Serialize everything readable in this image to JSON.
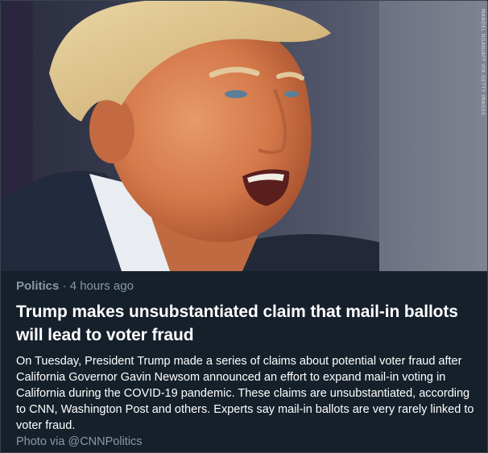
{
  "story": {
    "category": "Politics",
    "separator": "·",
    "time": "4 hours ago",
    "headline": "Trump makes unsubstantiated claim that mail-in ballots will lead to voter fraud",
    "summary": "On Tuesday, President Trump made a series of claims about potential voter fraud after California Governor Gavin Newsom announced an effort to expand mail-in voting in California during the COVID-19 pandemic. These claims are unsubstantiated, according to CNN, Washington Post and others. Experts say mail-in ballots are very rarely linked to voter fraud.",
    "credit": "Photo via @CNNPolitics"
  },
  "image": {
    "watermark": "MANDEL NGAN/AFP VIA GETTY IMAGES"
  },
  "colors": {
    "background": "#15202b",
    "secondary_text": "#8899a6",
    "primary_text": "#ffffff",
    "border": "#38444d"
  }
}
